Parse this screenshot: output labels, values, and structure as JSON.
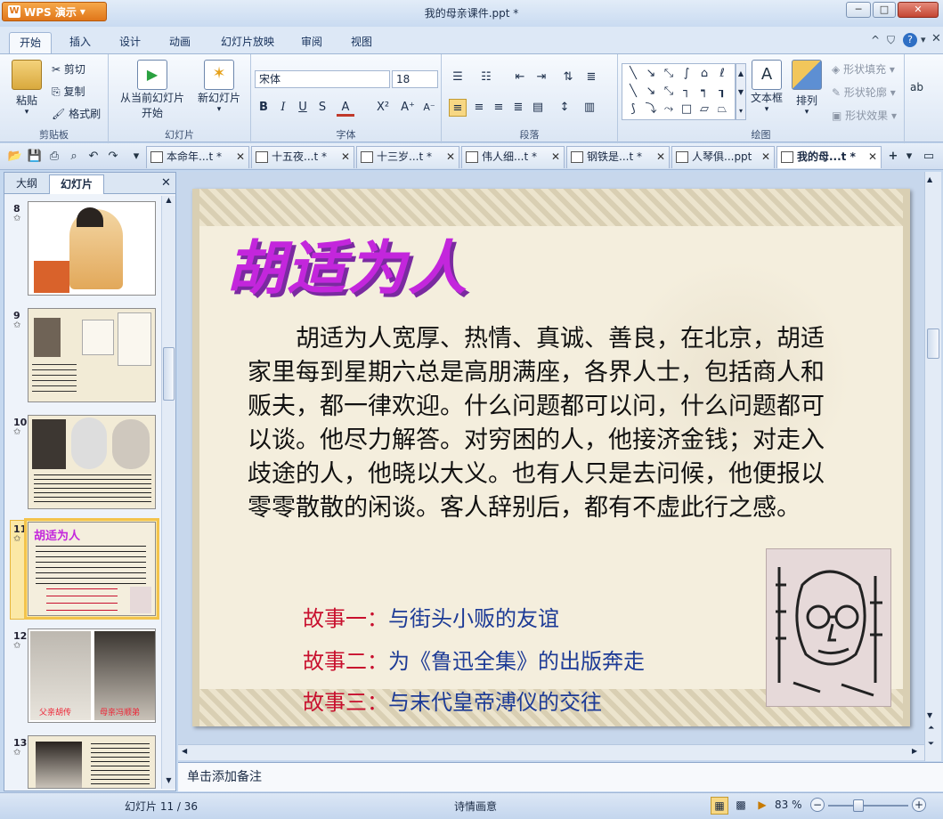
{
  "app": {
    "badge": "WPS 演示",
    "title": "我的母亲课件.ppt *"
  },
  "window_buttons": {
    "min": "─",
    "max": "□",
    "close": "✕"
  },
  "ribbon_tabs": [
    "开始",
    "插入",
    "设计",
    "动画",
    "幻灯片放映",
    "审阅",
    "视图"
  ],
  "ribbon_right_icons": [
    "caret-up-icon",
    "tshirt-skin-icon",
    "help-icon",
    "chevron-down-icon"
  ],
  "ribbon": {
    "clipboard": {
      "paste": "粘贴",
      "cut": "剪切",
      "copy": "复制",
      "format_painter": "格式刷",
      "label": "剪贴板"
    },
    "slides": {
      "from_current_1": "从当前幻灯片",
      "from_current_2": "开始",
      "new_slide": "新幻灯片",
      "label": "幻灯片"
    },
    "font": {
      "name": "宋体",
      "size": "18",
      "label": "字体"
    },
    "paragraph": {
      "label": "段落"
    },
    "drawing": {
      "textbox": "文本框",
      "arrange": "排列",
      "shape_fill": "形状填充",
      "shape_outline": "形状轮廓",
      "shape_effect": "形状效果",
      "label": "绘图"
    }
  },
  "doc_tabs": [
    {
      "label": "本命年...t *",
      "active": false
    },
    {
      "label": "十五夜...t *",
      "active": false
    },
    {
      "label": "十三岁...t *",
      "active": false
    },
    {
      "label": "伟人细...t *",
      "active": false
    },
    {
      "label": "钢铁是...t *",
      "active": false
    },
    {
      "label": "人琴俱...ppt",
      "active": false
    },
    {
      "label": "我的母...t *",
      "active": true
    }
  ],
  "side_panel": {
    "tabs": [
      "大纲",
      "幻灯片"
    ],
    "thumbs": [
      {
        "num": "8",
        "selected": false
      },
      {
        "num": "9",
        "selected": false
      },
      {
        "num": "10",
        "selected": false
      },
      {
        "num": "11",
        "selected": true,
        "title": "胡适为人"
      },
      {
        "num": "12",
        "selected": false,
        "captions": [
          "父亲胡传",
          "母亲冯顺弟"
        ]
      },
      {
        "num": "13",
        "selected": false
      }
    ]
  },
  "slide": {
    "title": "胡适为人",
    "body": "胡适为人宽厚、热情、真诚、善良，在北京，胡适家里每到星期六总是高朋满座，各界人士，包括商人和贩夫，都一律欢迎。什么问题都可以问，什么问题都可以谈。他尽力解答。对穷困的人，他接济金钱；对走入歧途的人，他晓以大义。也有人只是去问候，他便报以零零散散的闲谈。客人辞别后，都有不虚此行之感。",
    "stories": [
      {
        "key": "故事一：",
        "value": "与街头小贩的友谊"
      },
      {
        "key": "故事二：",
        "value": "为《鲁迅全集》的出版奔走"
      },
      {
        "key": "故事三：",
        "value": "与末代皇帝溥仪的交往"
      }
    ]
  },
  "notes_placeholder": "单击添加备注",
  "status": {
    "slide_counter": "幻灯片 11 / 36",
    "theme": "诗情画意",
    "zoom": "83 %"
  },
  "colors": {
    "accent": "#e0761a",
    "title_purple": "#c326dc",
    "story_red": "#c8102e",
    "story_blue": "#1d3b96",
    "selection": "#f3c34b"
  }
}
